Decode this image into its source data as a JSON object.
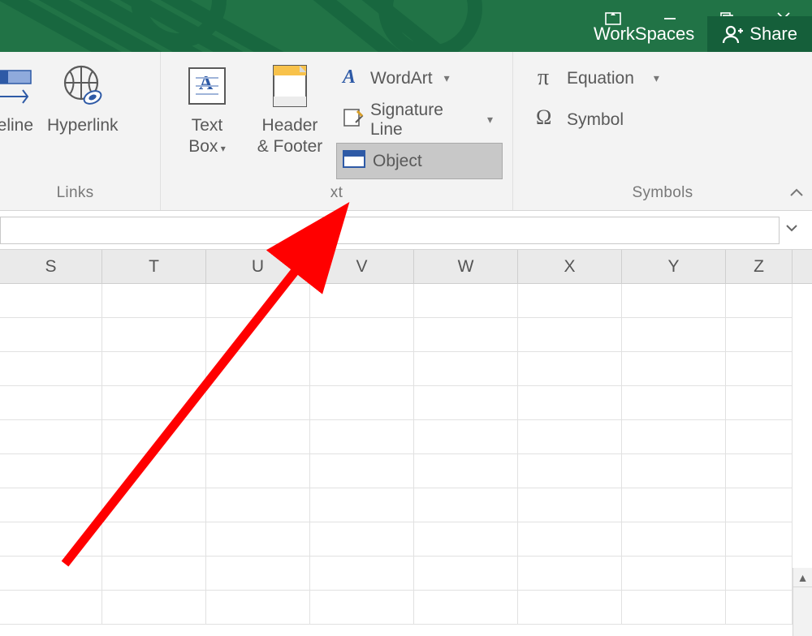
{
  "titlebar": {
    "workspaces": "WorkSpaces",
    "share": "Share"
  },
  "ribbon": {
    "group_links": {
      "label": "Links",
      "timeline": "neline",
      "hyperlink": "Hyperlink"
    },
    "group_text": {
      "label": "xt",
      "textbox_line1": "Text",
      "textbox_line2": "Box",
      "headerfooter_line1": "Header",
      "headerfooter_line2": "& Footer",
      "wordart": "WordArt",
      "sigline": "Signature Line",
      "object": "Object"
    },
    "group_symbols": {
      "label": "Symbols",
      "equation": "Equation",
      "symbol": "Symbol"
    }
  },
  "columns": [
    {
      "letter": "S",
      "w": 126
    },
    {
      "letter": "T",
      "w": 128
    },
    {
      "letter": "U",
      "w": 128
    },
    {
      "letter": "V",
      "w": 128
    },
    {
      "letter": "W",
      "w": 128
    },
    {
      "letter": "X",
      "w": 128
    },
    {
      "letter": "Y",
      "w": 128
    },
    {
      "letter": "Z",
      "w": 82
    }
  ],
  "row_count": 10
}
